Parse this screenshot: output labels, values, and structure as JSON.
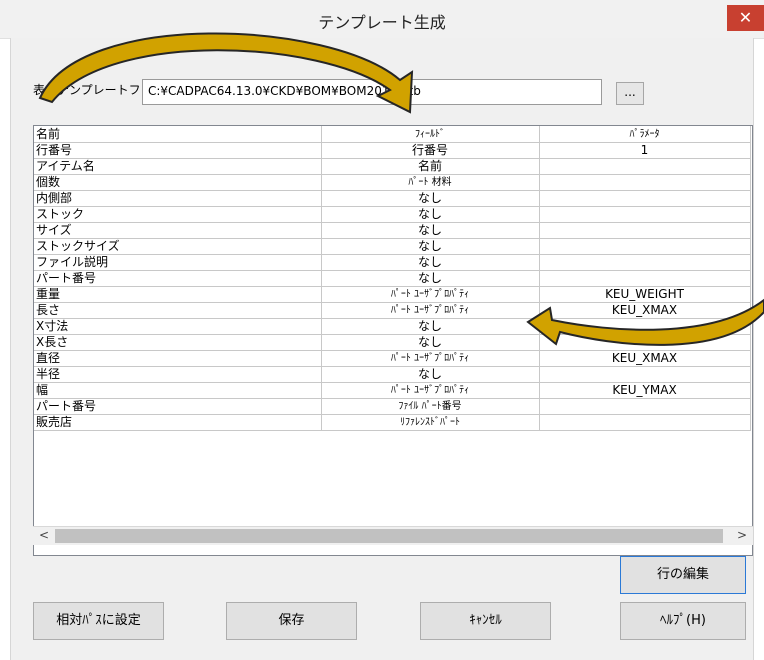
{
  "dialog": {
    "title": "テンプレート生成",
    "close_glyph": "✕",
    "file_label": "表のテンプレートファイル",
    "file_value": "C:¥CADPAC64.13.0¥CKD¥BOM¥BOM2015.btb",
    "browse_label": "..."
  },
  "grid": {
    "headers": [
      "名前",
      "ﾌｨｰﾙﾄﾞ",
      "ﾊﾟﾗﾒｰﾀ"
    ],
    "rows": [
      [
        "行番号",
        "行番号",
        "1"
      ],
      [
        "アイテム名",
        "名前",
        ""
      ],
      [
        "個数",
        "ﾊﾟｰﾄ 材料",
        ""
      ],
      [
        "内側部",
        "なし",
        ""
      ],
      [
        "ストック",
        "なし",
        ""
      ],
      [
        "サイズ",
        "なし",
        ""
      ],
      [
        "ストックサイズ",
        "なし",
        ""
      ],
      [
        "ファイル説明",
        "なし",
        ""
      ],
      [
        "パート番号",
        "なし",
        ""
      ],
      [
        "重量",
        "ﾊﾟｰﾄ ﾕｰｻﾞﾌﾟﾛﾊﾟﾃｨ",
        "KEU_WEIGHT"
      ],
      [
        "長さ",
        "ﾊﾟｰﾄ ﾕｰｻﾞﾌﾟﾛﾊﾟﾃｨ",
        "KEU_XMAX"
      ],
      [
        "X寸法",
        "なし",
        ""
      ],
      [
        "X長さ",
        "なし",
        ""
      ],
      [
        "直径",
        "ﾊﾟｰﾄ ﾕｰｻﾞﾌﾟﾛﾊﾟﾃｨ",
        "KEU_XMAX"
      ],
      [
        "半径",
        "なし",
        ""
      ],
      [
        "幅",
        "ﾊﾟｰﾄ ﾕｰｻﾞﾌﾟﾛﾊﾟﾃｨ",
        "KEU_YMAX"
      ],
      [
        "パート番号",
        "ﾌｧｲﾙ ﾊﾟｰﾄ番号",
        ""
      ],
      [
        "販売店",
        "ﾘﾌｧﾚﾝｽﾄﾞﾊﾟｰﾄ",
        ""
      ]
    ],
    "scroll_left": "<",
    "scroll_right": ">"
  },
  "buttons": {
    "edit_row": "行の編集",
    "relative_path": "相対ﾊﾟｽに設定",
    "save": "保存",
    "cancel": "ｷｬﾝｾﾙ",
    "help": "ﾍﾙﾌﾟ(H)"
  },
  "colors": {
    "close_button": "#c84030",
    "arrow_fill": "#d1a200",
    "arrow_outline": "#262626",
    "dialog_background": "#f0f0f0"
  }
}
